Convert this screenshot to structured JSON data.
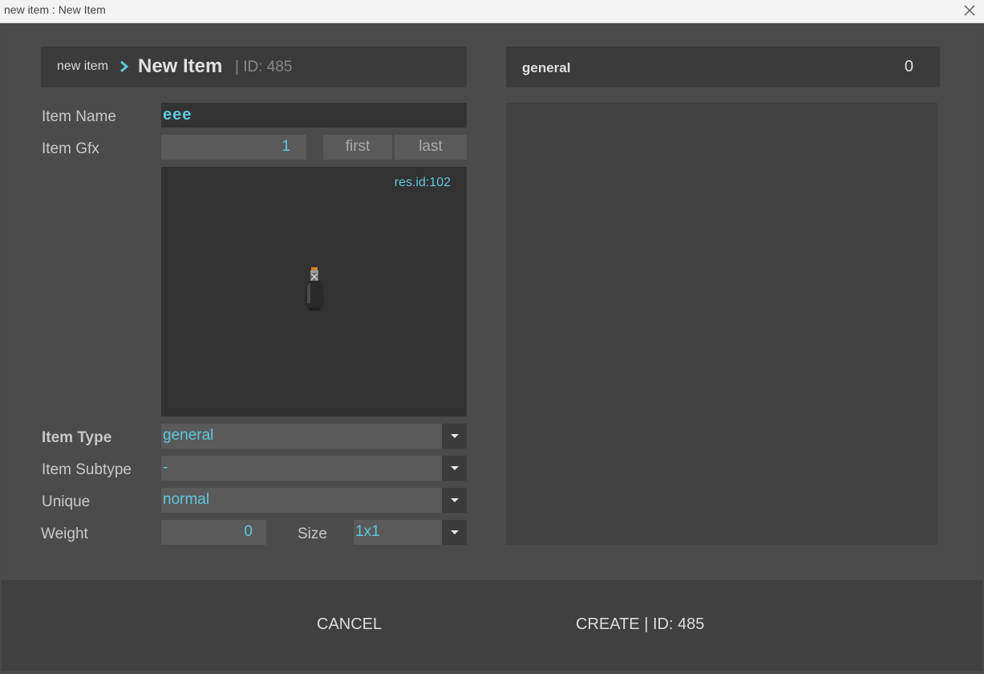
{
  "window": {
    "title": "new item : New Item"
  },
  "breadcrumb": {
    "parent": "new item",
    "current": "New Item",
    "id_text": "| ID: 485"
  },
  "form": {
    "name_label": "Item Name",
    "name_value": "eee",
    "gfx_label": "Item Gfx",
    "gfx_value": "1",
    "first_label": "first",
    "last_label": "last",
    "res_id": "res.id:102",
    "type_label": "Item Type",
    "type_value": "general",
    "subtype_label": "Item Subtype",
    "subtype_value": "-",
    "unique_label": "Unique",
    "unique_value": "normal",
    "weight_label": "Weight",
    "weight_value": "0",
    "size_label": "Size",
    "size_value": "1x1"
  },
  "right_panel": {
    "header": "general",
    "count": "0"
  },
  "footer": {
    "cancel": "CANCEL",
    "create": "CREATE | ID: 485"
  },
  "colors": {
    "accent": "#5ec7dd",
    "background": "#4b4b4b",
    "header": "#3b3b3b"
  },
  "icons": {
    "close": "close-icon",
    "chevron": "chevron-right-icon",
    "item": "potion-bottle-icon",
    "dropdown": "chevron-down-icon"
  }
}
